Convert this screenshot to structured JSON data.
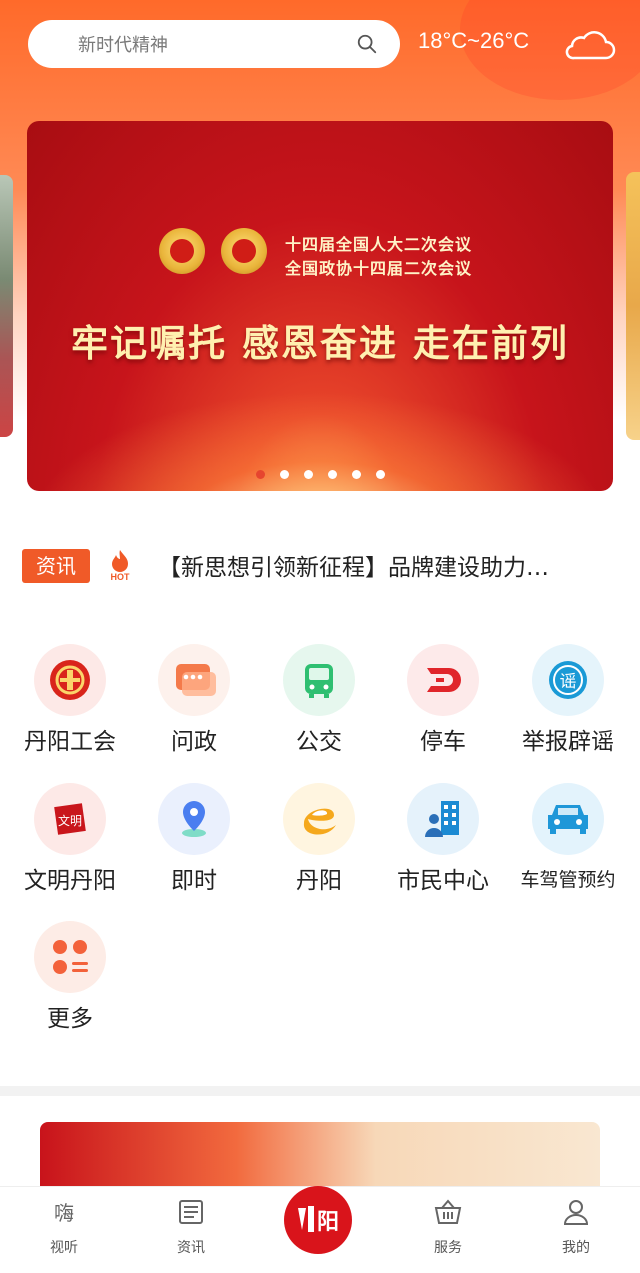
{
  "search": {
    "placeholder": "新时代精神"
  },
  "weather": {
    "temp": "18°C~26°C",
    "icon": "cloud-icon"
  },
  "banner": {
    "line1": "十四届全国人大二次会议",
    "line2": "全国政协十四届二次会议",
    "title": "牢记嘱托 感恩奋进 走在前列",
    "dot_count": 6,
    "active_dot": 0
  },
  "news": {
    "tag": "资讯",
    "hot": "HOT",
    "headline": "【新思想引领新征程】品牌建设助力…"
  },
  "services": [
    {
      "label": "丹阳工会",
      "icon": "trade-union-icon"
    },
    {
      "label": "问政",
      "icon": "chat-icon"
    },
    {
      "label": "公交",
      "icon": "bus-icon"
    },
    {
      "label": "停车",
      "icon": "parking-icon"
    },
    {
      "label": "举报辟谣",
      "icon": "rumor-icon"
    },
    {
      "label": "文明丹阳",
      "icon": "civilization-icon"
    },
    {
      "label": "即时",
      "icon": "location-pin-icon"
    },
    {
      "label": "丹阳",
      "icon": "danyang-e-icon"
    },
    {
      "label": "市民中心",
      "icon": "citizen-center-icon"
    },
    {
      "label": "车驾管预约",
      "icon": "car-icon"
    },
    {
      "label": "更多",
      "icon": "more-grid-icon"
    }
  ],
  "promo": {
    "text": ""
  },
  "tabs": [
    {
      "label": "视听",
      "icon": "video-icon"
    },
    {
      "label": "资讯",
      "icon": "news-icon"
    },
    {
      "label": "",
      "icon": "home-logo-icon"
    },
    {
      "label": "服务",
      "icon": "basket-icon"
    },
    {
      "label": "我的",
      "icon": "user-icon"
    }
  ],
  "colors": {
    "accent": "#f05a28",
    "brand_red": "#d9141b"
  }
}
